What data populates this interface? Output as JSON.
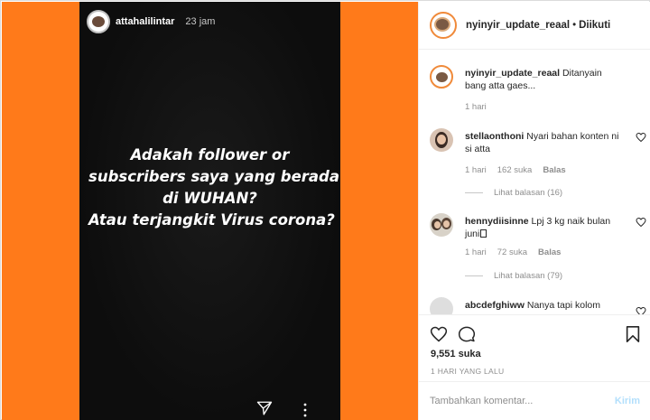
{
  "story": {
    "username": "attahalilintar",
    "time": "23 jam",
    "lines": [
      "Adakah follower or",
      "subscribers saya yang berada",
      "di WUHAN?",
      "Atau terjangkit Virus corona?"
    ],
    "icons": {
      "send": "send-icon",
      "more": "more-vertical-icon"
    },
    "colors": {
      "background": "#ff7a1a",
      "story_bg": "#121212"
    }
  },
  "header": {
    "username": "nyinyir_update_reaal",
    "separator": "•",
    "follow_status": "Diikuti"
  },
  "caption": {
    "username": "nyinyir_update_reaal",
    "text": "Ditanyain bang atta gaes...",
    "time": "1 hari"
  },
  "comments": [
    {
      "username": "stellaonthoni",
      "text": "Nyari bahan konten ni si atta",
      "time": "1 hari",
      "likes": "162 suka",
      "reply": "Balas",
      "view_replies": "Lihat balasan (16)"
    },
    {
      "username": "hennydiisinne",
      "text": "Lpj 3 kg naik bulan juni",
      "time": "1 hari",
      "likes": "72 suka",
      "reply": "Balas",
      "view_replies": "Lihat balasan (79)"
    },
    {
      "username": "abcdefghiww",
      "text": "Nanya tapi kolom"
    }
  ],
  "actions": {
    "likes": "9,551 suka",
    "date": "1 HARI YANG LALU"
  },
  "composer": {
    "placeholder": "Tambahkan komentar...",
    "post_label": "Kirim"
  }
}
